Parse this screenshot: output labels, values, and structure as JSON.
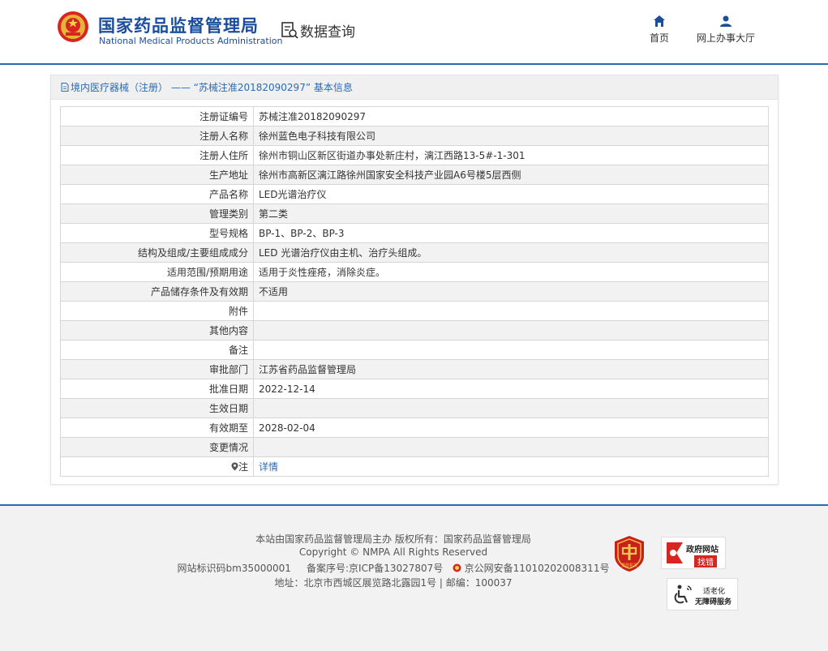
{
  "header": {
    "title_cn": "国家药品监督管理局",
    "title_en": "National Medical Products Administration",
    "query_label": "数据查询",
    "nav": [
      {
        "label": "首页",
        "icon": "home-icon"
      },
      {
        "label": "网上办事大厅",
        "icon": "user-icon"
      }
    ]
  },
  "panel": {
    "breadcrumb": "境内医疗器械（注册） —— “苏械注准20182090297” 基本信息",
    "rows": [
      {
        "label": "注册证编号",
        "value": "苏械注准20182090297"
      },
      {
        "label": "注册人名称",
        "value": "徐州蓝色电子科技有限公司"
      },
      {
        "label": "注册人住所",
        "value": "徐州市铜山区新区街道办事处新庄村，漓江西路13-5#-1-301"
      },
      {
        "label": "生产地址",
        "value": "徐州市高新区漓江路徐州国家安全科技产业园A6号楼5层西侧"
      },
      {
        "label": "产品名称",
        "value": "LED光谱治疗仪"
      },
      {
        "label": "管理类别",
        "value": "第二类"
      },
      {
        "label": "型号规格",
        "value": "BP-1、BP-2、BP-3"
      },
      {
        "label": "结构及组成/主要组成成分",
        "value": "LED 光谱治疗仪由主机、治疗头组成。"
      },
      {
        "label": "适用范围/预期用途",
        "value": "适用于炎性痤疮，消除炎症。"
      },
      {
        "label": "产品储存条件及有效期",
        "value": "不适用"
      },
      {
        "label": "附件",
        "value": ""
      },
      {
        "label": "其他内容",
        "value": ""
      },
      {
        "label": "备注",
        "value": ""
      },
      {
        "label": "审批部门",
        "value": "江苏省药品监督管理局"
      },
      {
        "label": "批准日期",
        "value": "2022-12-14"
      },
      {
        "label": "生效日期",
        "value": ""
      },
      {
        "label": "有效期至",
        "value": "2028-02-04"
      },
      {
        "label": "变更情况",
        "value": ""
      }
    ],
    "note_label": "注",
    "note_link": "详情"
  },
  "footer": {
    "line1": "本站由国家药品监督管理局主办 版权所有：国家药品监督管理局",
    "line2": "Copyright © NMPA All Rights Reserved",
    "line3_a": "网站标识码bm35000001",
    "line3_b": "备案序号:京ICP备13027807号",
    "line3_c": "京公网安备11010202008311号",
    "line4": "地址：北京市西城区展览路北露园1号 | 邮编：100037",
    "badge_party": "党政机关",
    "badge_gov_1": "政府网站",
    "badge_gov_2": "找错",
    "badge_acc_1": "适老化",
    "badge_acc_2": "无障碍服务"
  },
  "colors": {
    "brand_blue": "#1a4e9c",
    "link_blue": "#2a6bb3",
    "red": "#d7261e"
  }
}
